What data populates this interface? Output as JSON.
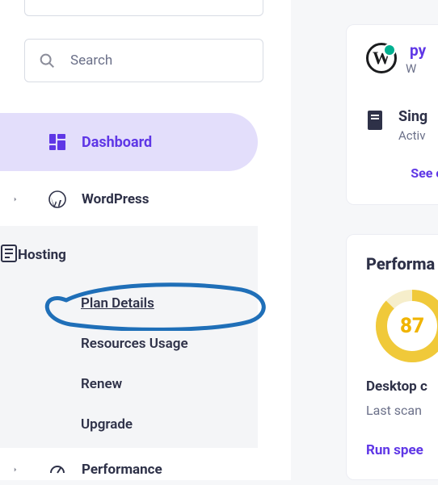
{
  "search": {
    "placeholder": "Search"
  },
  "sidebar": {
    "dashboard_label": "Dashboard",
    "wordpress_label": "WordPress",
    "hosting_label": "Hosting",
    "performance_label": "Performance",
    "hosting_sub": {
      "plan_details": "Plan Details",
      "resources_usage": "Resources Usage",
      "renew": "Renew",
      "upgrade": "Upgrade"
    }
  },
  "colors": {
    "accent": "#5f37e6",
    "accent_bg": "#e3defb",
    "text": "#2e3148",
    "muted": "#6b7089",
    "donut": "#f0c93a",
    "status_dot": "#00b090"
  },
  "card_site": {
    "title_prefix": "py",
    "subtitle_prefix": "W",
    "plan_name_prefix": "Sing",
    "plan_status_prefix": "Activ",
    "see_link_prefix": "See c"
  },
  "card_perf": {
    "heading_prefix": "Performa",
    "score": "87",
    "desktop_label_prefix": "Desktop c",
    "last_scan_prefix": "Last scan ",
    "run_link_prefix": "Run spee"
  }
}
